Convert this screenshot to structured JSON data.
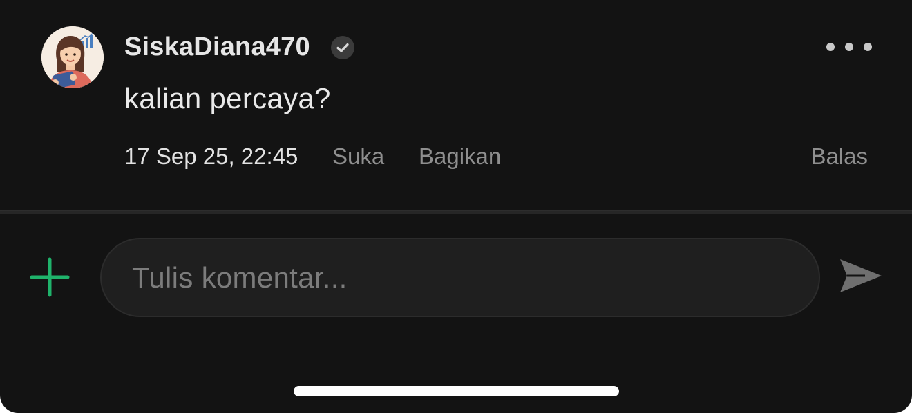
{
  "comment": {
    "username": "SiskaDiana470",
    "text": "kalian percaya?",
    "timestamp": "17 Sep 25, 22:45",
    "actions": {
      "like_label": "Suka",
      "share_label": "Bagikan",
      "reply_label": "Balas"
    },
    "icons": {
      "avatar": "woman-with-tablet-illustration",
      "verified": "check-badge-icon",
      "more": "more-horizontal-icon"
    }
  },
  "composer": {
    "placeholder": "Tulis komentar...",
    "value": "",
    "icons": {
      "add": "plus-icon",
      "send": "send-icon"
    }
  },
  "colors": {
    "background": "#131313",
    "accent_green": "#1fb36b",
    "text_primary": "#e6e6e6",
    "text_muted": "#8f8f8f",
    "input_bg": "#1f1f1f"
  }
}
